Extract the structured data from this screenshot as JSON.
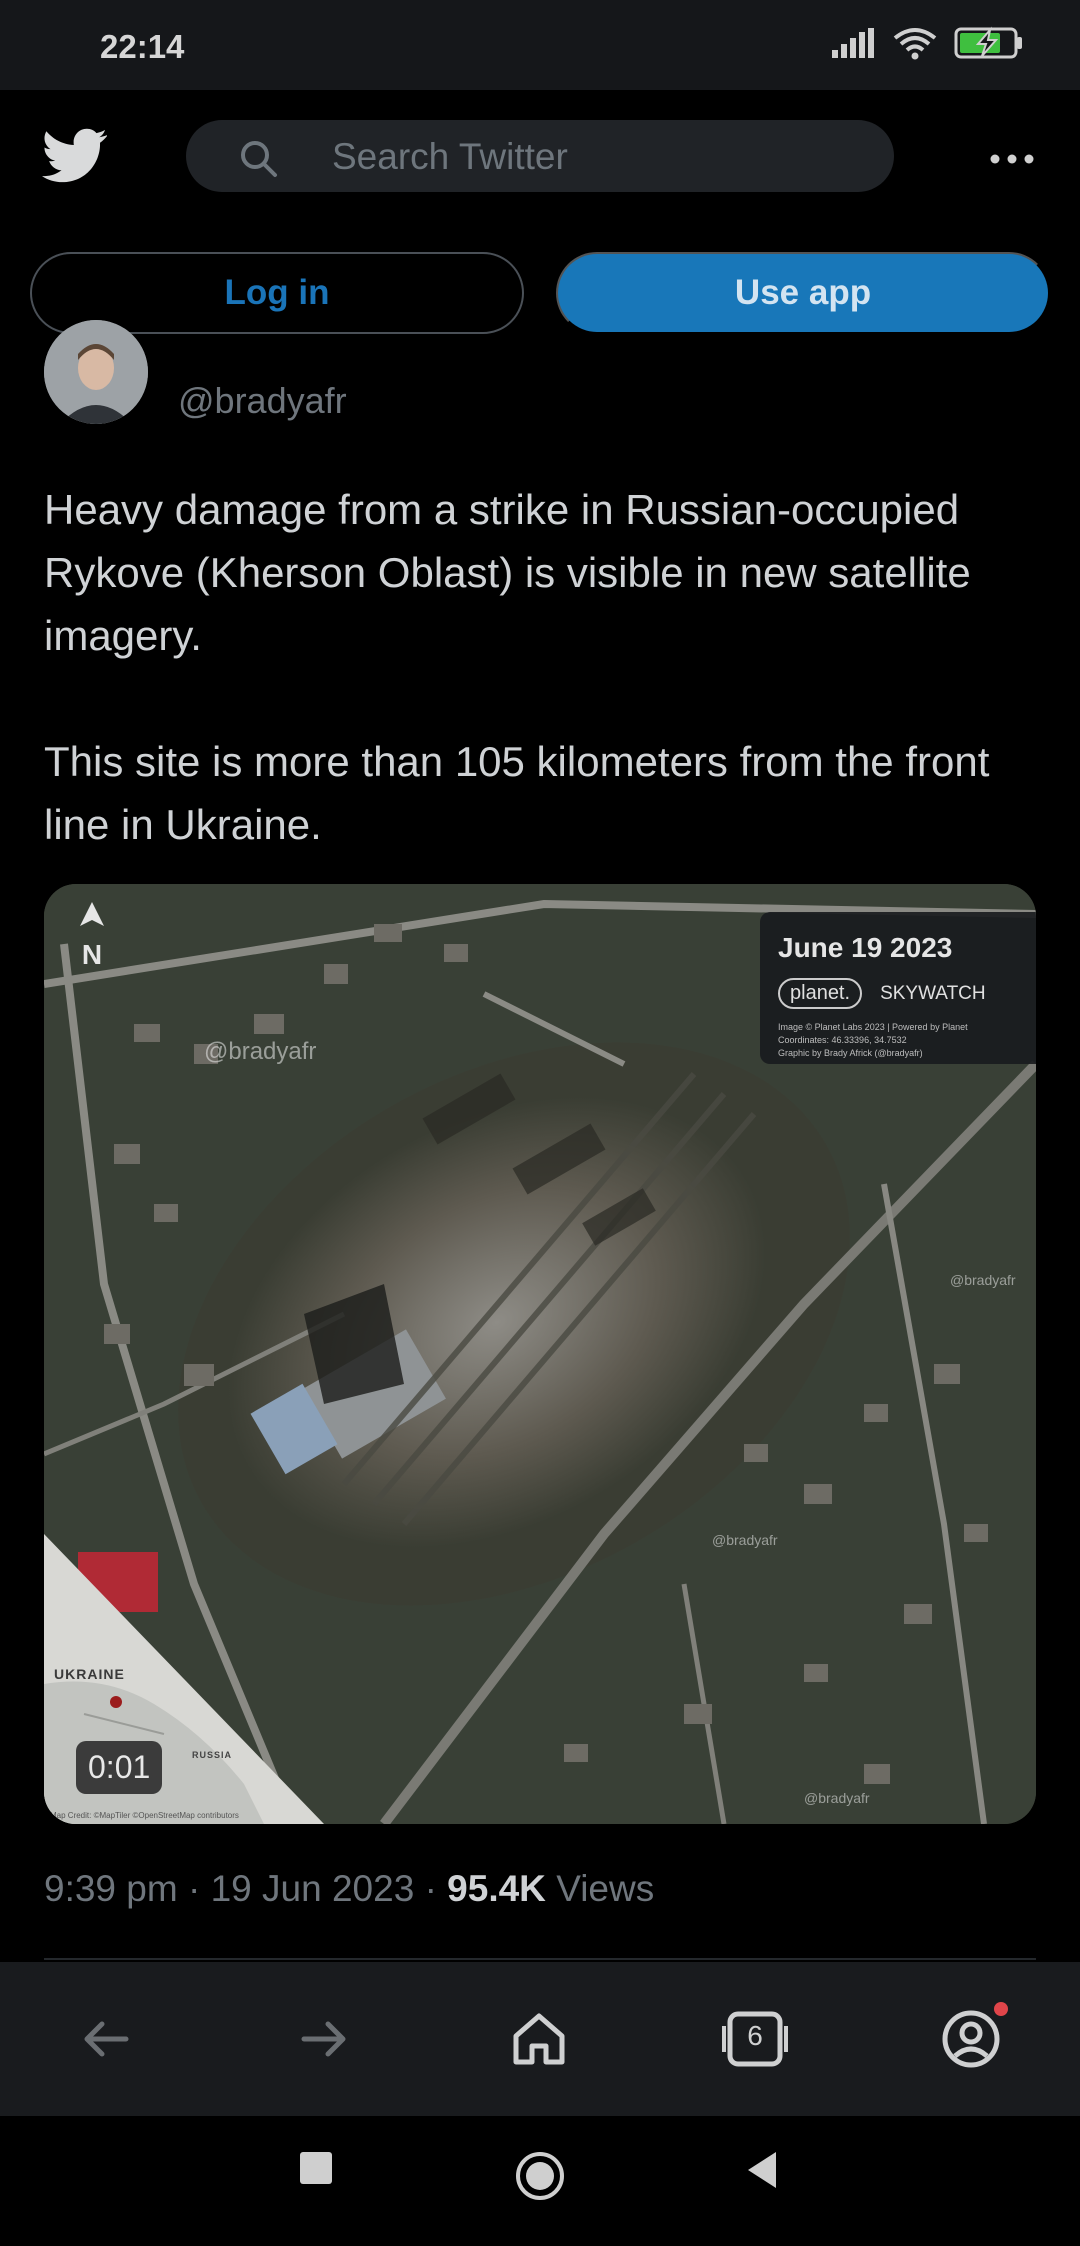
{
  "status_bar": {
    "time": "22:14",
    "icons": [
      "signal-icon",
      "wifi-icon",
      "battery-charging-icon"
    ]
  },
  "header": {
    "logo_icon": "twitter-bird-icon",
    "search_placeholder": "Search Twitter",
    "more_icon": "more-horizontal-icon"
  },
  "auth": {
    "login_label": "Log in",
    "use_app_label": "Use app"
  },
  "tweet": {
    "handle": "@bradyafr",
    "text_paragraphs": [
      "Heavy damage from a strike in Russian-occupied Rykove (Kherson Oblast) is visible in new satellite imagery.",
      "This site is more than 105 kilometers from the front line in Ukraine."
    ],
    "media": {
      "date_title": "June 19 2023",
      "brand_planet": "planet.",
      "brand_skywatch": "SKYWATCH",
      "credit_lines": [
        "Image © Planet Labs 2023 | Powered by Planet",
        "Coordinates: 46.33396, 34.7532",
        "Graphic by Brady Africk (@bradyafr)"
      ],
      "watermark": "@bradyafr",
      "north_label": "N",
      "map_label_ukraine": "UKRAINE",
      "map_label_russia": "RUSSIA",
      "map_credit": "Map Credit: ©MapTiler ©OpenStreetMap contributors",
      "duration": "0:01"
    },
    "time": "9:39 pm",
    "separator": "·",
    "date": "19 Jun 2023",
    "views_count": "95.4K",
    "views_label": "Views"
  },
  "browser_nav": {
    "tab_count": "6",
    "items": [
      "back-arrow-icon",
      "forward-arrow-icon",
      "home-icon",
      "tabs-icon",
      "profile-icon"
    ],
    "notification_color": "#e0454a"
  },
  "system_nav": {
    "items": [
      "recents-square-icon",
      "home-circle-icon",
      "back-triangle-icon"
    ]
  },
  "colors": {
    "accent": "#1877b9",
    "login_text": "#1a74b8"
  }
}
